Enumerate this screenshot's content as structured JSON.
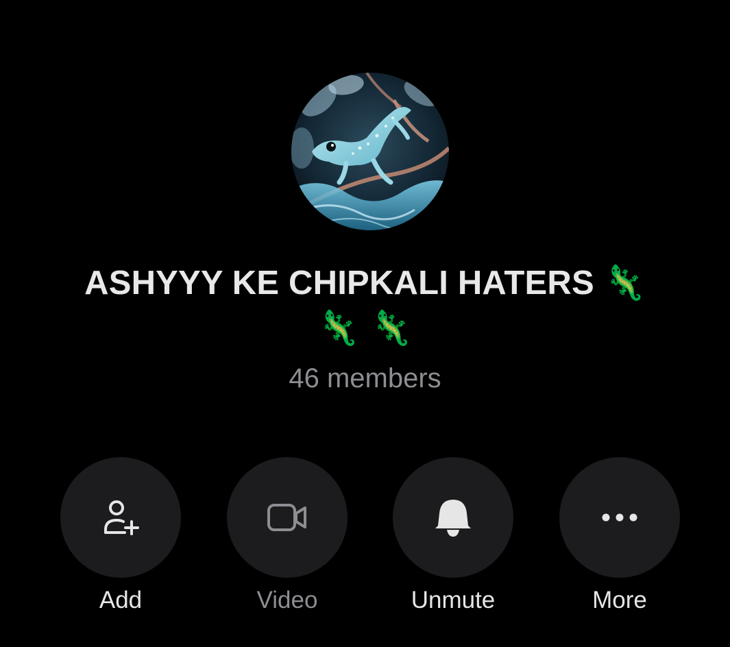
{
  "group": {
    "name": "ASHYYY KE CHIPKALI HATERS",
    "name_emoji": "🦎",
    "emoji_line": "🦎 🦎",
    "member_count": "46 members",
    "avatar_icon": "lizard-avatar"
  },
  "actions": [
    {
      "label": "Add",
      "icon": "add-person-icon",
      "enabled": true
    },
    {
      "label": "Video",
      "icon": "video-camera-icon",
      "enabled": false
    },
    {
      "label": "Unmute",
      "icon": "bell-icon",
      "enabled": true
    },
    {
      "label": "More",
      "icon": "more-dots-icon",
      "enabled": true
    }
  ],
  "colors": {
    "background": "#000000",
    "button_bg": "#1c1c1e",
    "primary_text": "#e6e6e6",
    "secondary_text": "#8d8d92"
  }
}
